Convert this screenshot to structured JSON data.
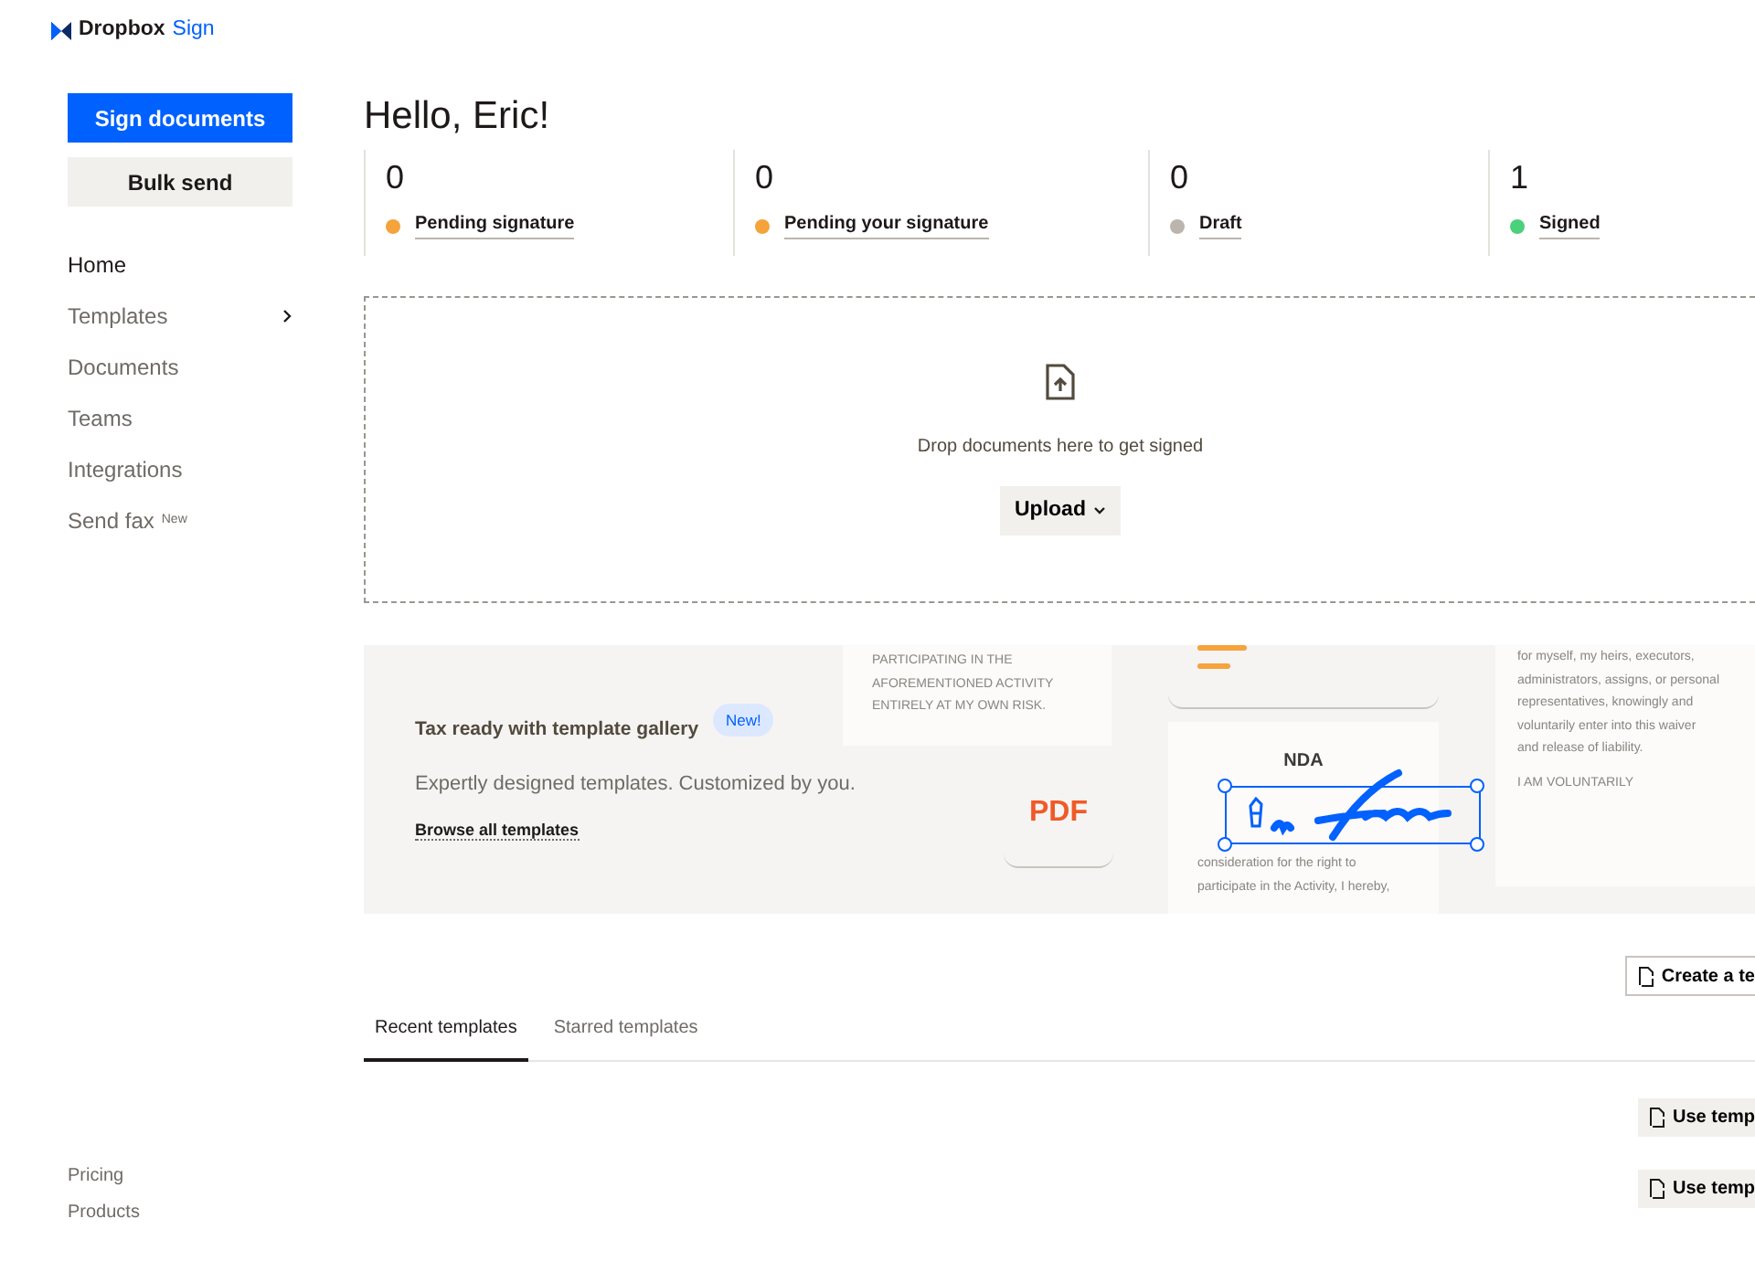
{
  "logo": {
    "brand": "Dropbox",
    "product": "Sign"
  },
  "sidebar": {
    "buttons": [
      {
        "label": "Sign documents",
        "kind": "primary"
      },
      {
        "label": "Bulk send",
        "kind": "secondary"
      }
    ],
    "items": [
      {
        "label": "Home",
        "selected": true,
        "has_submenu": false
      },
      {
        "label": "Templates",
        "selected": false,
        "has_submenu": true
      },
      {
        "label": "Documents",
        "selected": false,
        "has_submenu": false
      },
      {
        "label": "Teams",
        "selected": false,
        "has_submenu": false
      },
      {
        "label": "Integrations",
        "selected": false,
        "has_submenu": false
      },
      {
        "label": "Send fax",
        "selected": false,
        "has_submenu": false,
        "badge": "New"
      }
    ],
    "footer_links": [
      "Pricing",
      "Products"
    ]
  },
  "greeting": "Hello, Eric!",
  "stats": [
    {
      "count": "0",
      "label": "Pending signature",
      "color": "#f5a33b"
    },
    {
      "count": "0",
      "label": "Pending your signature",
      "color": "#f5a33b"
    },
    {
      "count": "0",
      "label": "Draft",
      "color": "#bbb5ae"
    },
    {
      "count": "1",
      "label": "Signed",
      "color": "#4cd07b"
    }
  ],
  "dropzone": {
    "text": "Drop documents here to get signed",
    "button": "Upload"
  },
  "banner": {
    "title": "Tax ready with template gallery",
    "badge": "New!",
    "description": "Expertly designed templates. Customized by you.",
    "link": "Browse all templates",
    "illustration": {
      "waiver_top": [
        "PARTICIPATING IN THE",
        "AFOREMENTIONED ACTIVITY",
        "ENTIRELY AT MY OWN RISK."
      ],
      "pdf_label": "PDF",
      "nda_title": "NDA",
      "nda_lines": [
        "consideration for the right to",
        "participate in the Activity, I hereby,"
      ],
      "waiver_right": [
        "for myself, my heirs, executors,",
        "administrators, assigns, or personal",
        "representatives, knowingly and",
        "voluntarily enter into this waiver",
        "and release of liability.",
        "I AM VOLUNTARILY"
      ]
    }
  },
  "create_button": "Create a te",
  "tabs": [
    {
      "label": "Recent templates",
      "selected": true
    },
    {
      "label": "Starred templates",
      "selected": false
    }
  ],
  "template_actions": [
    "Use temp",
    "Use temp"
  ]
}
